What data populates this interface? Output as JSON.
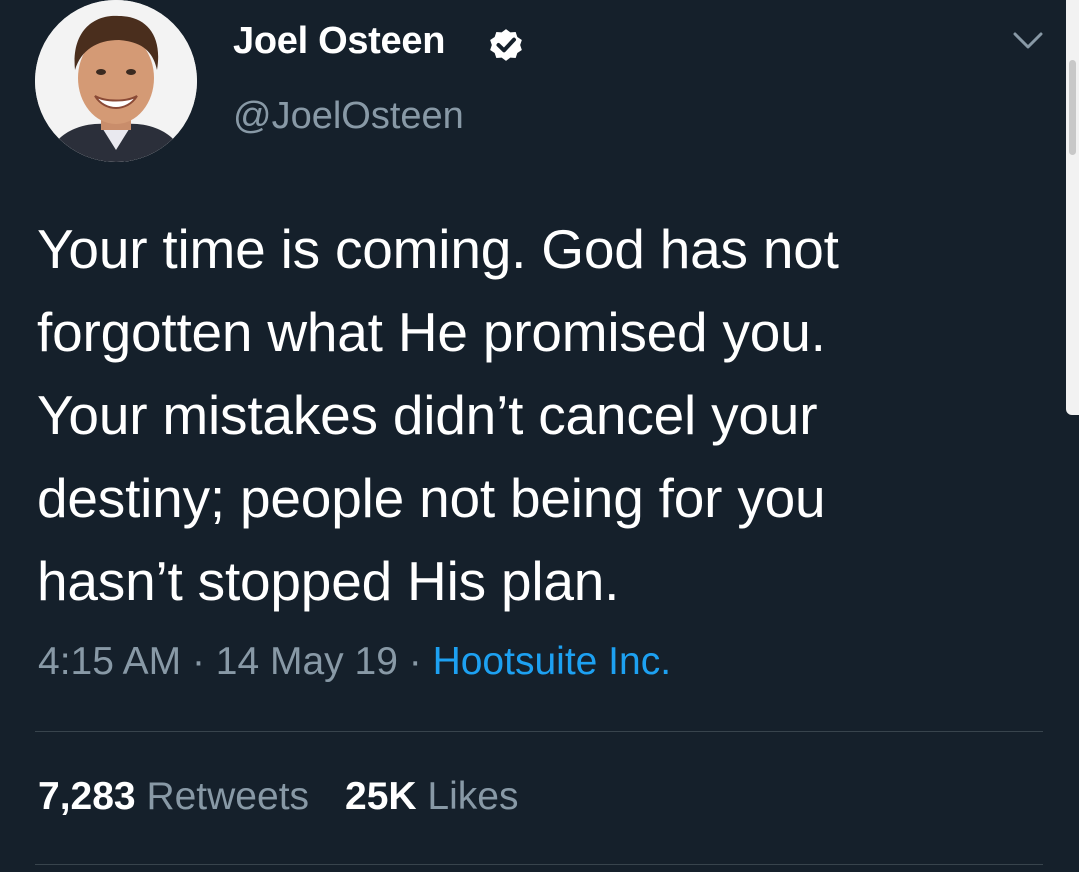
{
  "author": {
    "name": "Joel Osteen",
    "handle": "@JoelOsteen",
    "verified": true
  },
  "tweet": {
    "text_lines": [
      "Your time is coming. God has not",
      "forgotten what He promised you.",
      "Your mistakes didn’t cancel your",
      "destiny; people not being for you",
      "hasn’t stopped His plan."
    ],
    "time": "4:15 AM",
    "date": "14 May 19",
    "separator": "·",
    "source": "Hootsuite Inc."
  },
  "stats": {
    "retweets_count": "7,283",
    "retweets_label": "Retweets",
    "likes_count": "25K",
    "likes_label": "Likes"
  },
  "icons": {
    "verified": "verified-badge-icon",
    "menu": "chevron-down-icon"
  },
  "colors": {
    "background": "#15202b",
    "text": "#ffffff",
    "secondary_text": "#8899a6",
    "link": "#1da1f2",
    "divider": "#38444d"
  }
}
